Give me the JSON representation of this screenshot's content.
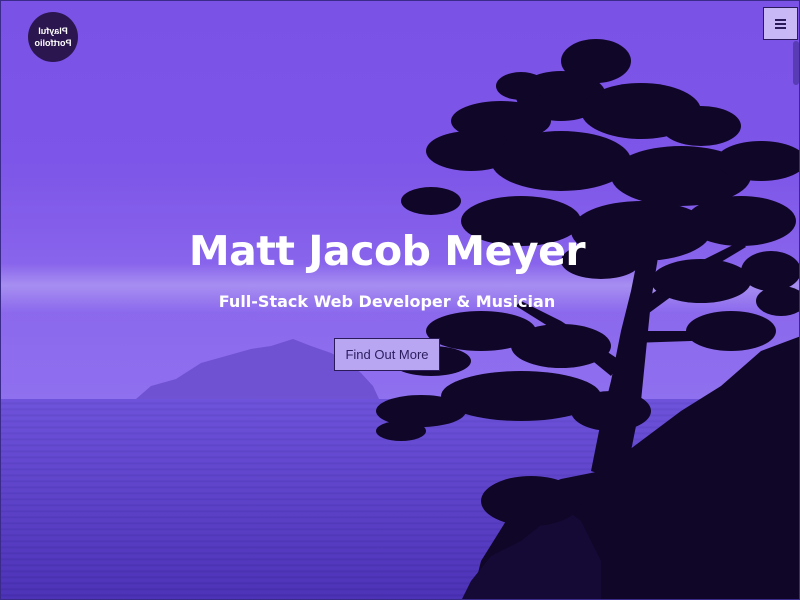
{
  "logo": {
    "line1": "Playful",
    "line2": "Portfolio"
  },
  "nav": {
    "menu_icon": "hamburger-icon"
  },
  "hero": {
    "title": "Matt Jacob Meyer",
    "subtitle": "Full-Stack Web Developer & Musician",
    "cta_label": "Find Out More",
    "background_image": "silhouetted cypress tree over purple ocean at dusk"
  },
  "colors": {
    "sky": "#7d55e8",
    "sea": "#5a3bd6",
    "silhouette": "#100628",
    "button": "#b9a6f2",
    "logo_bg": "#2b1650"
  }
}
